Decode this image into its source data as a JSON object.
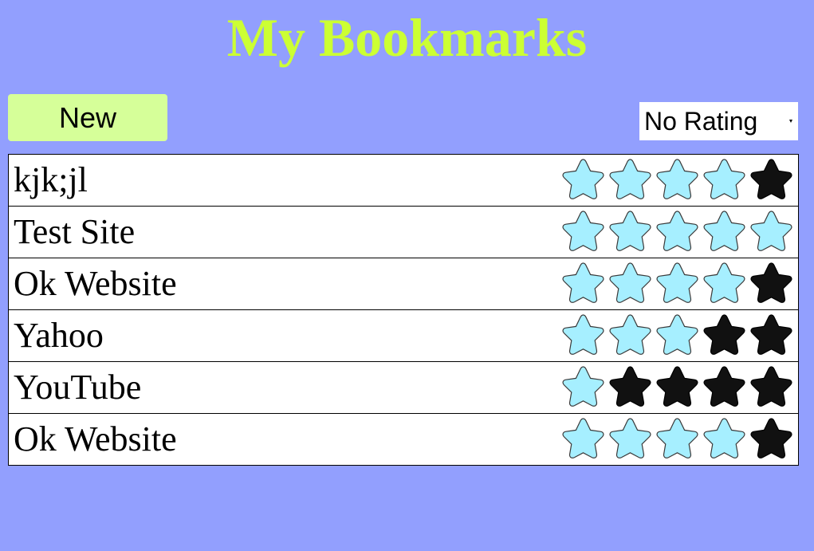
{
  "title": "My Bookmarks",
  "toolbar": {
    "new_label": "New",
    "rating_filter": "No Rating"
  },
  "colors": {
    "background": "#929ffe",
    "title": "#ccff33",
    "new_button": "#d6ff99",
    "star_filled": "#a6efff",
    "star_empty": "#111111"
  },
  "bookmarks": [
    {
      "name": "kjk;jl",
      "rating": 4
    },
    {
      "name": "Test Site",
      "rating": 5
    },
    {
      "name": "Ok Website",
      "rating": 4
    },
    {
      "name": "Yahoo",
      "rating": 3
    },
    {
      "name": "YouTube",
      "rating": 1
    },
    {
      "name": "Ok Website",
      "rating": 4
    }
  ],
  "max_rating": 5
}
